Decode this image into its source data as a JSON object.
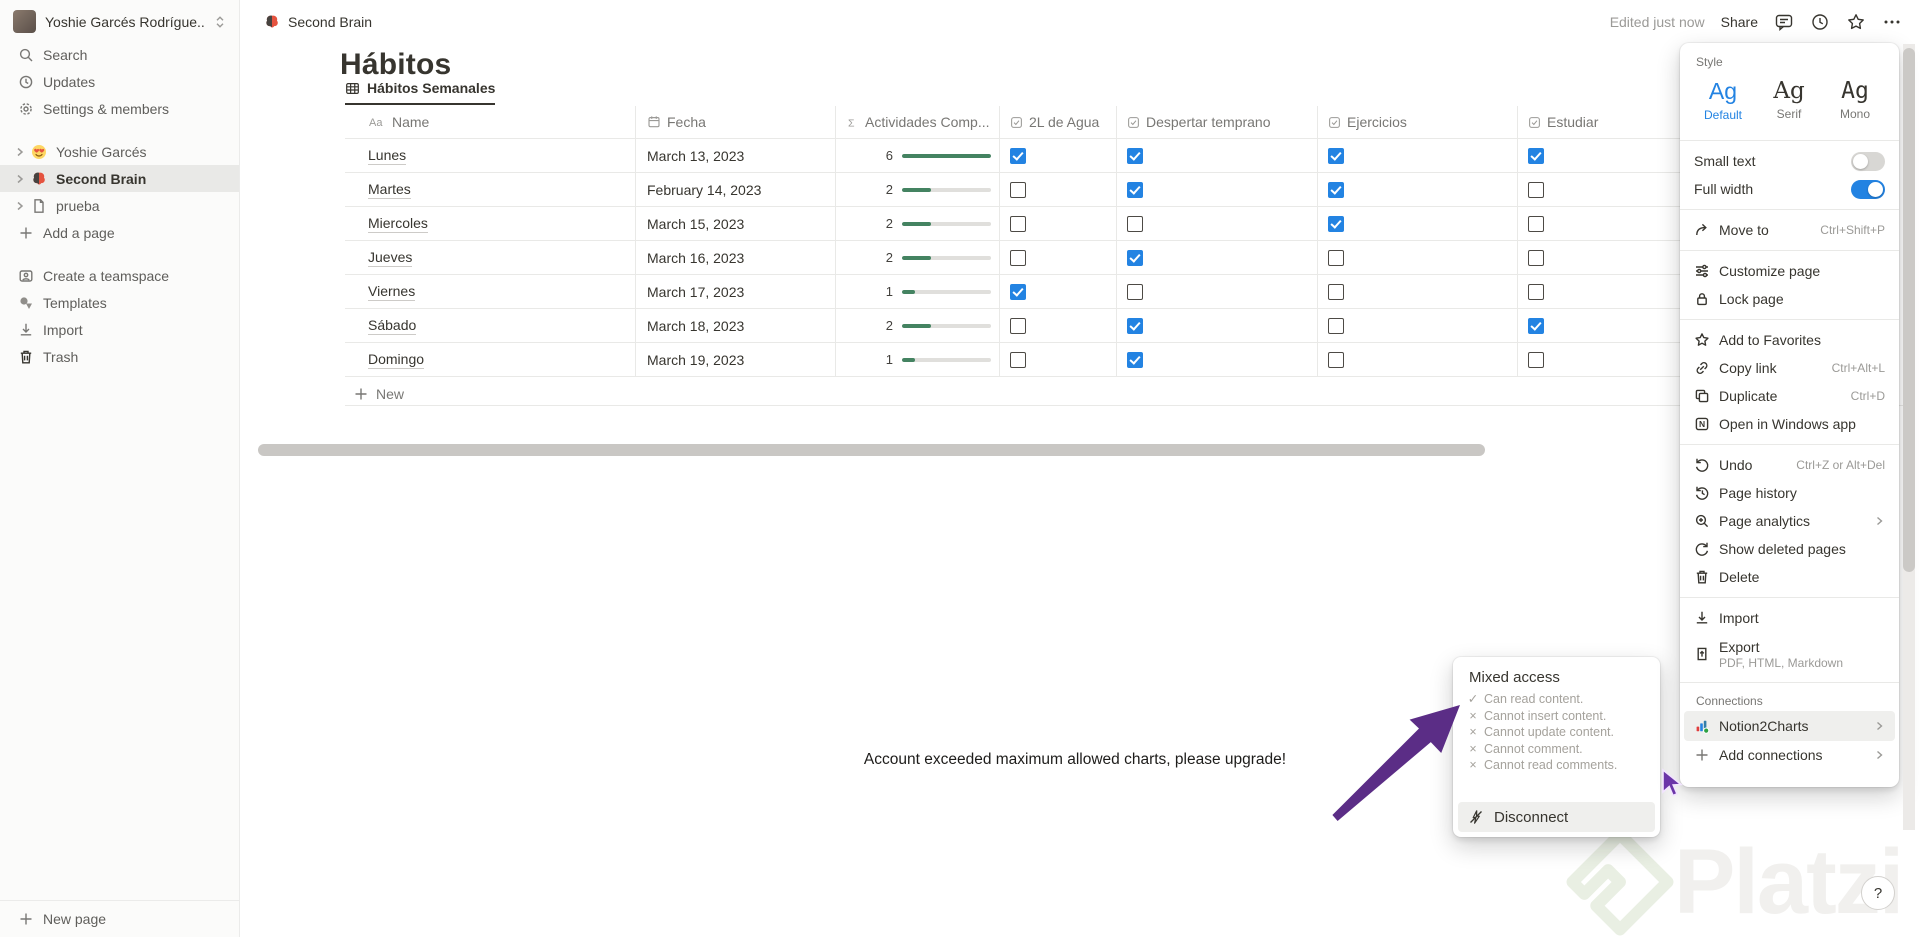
{
  "colors": {
    "accent": "#2383e2",
    "check_blue": "#2383e2",
    "progress_green": "#448361",
    "arrow_purple": "#5b2d86",
    "selected_bg": "#e9e9e7"
  },
  "sidebar": {
    "workspace": {
      "name": "Yoshie Garcés Rodrígue..."
    },
    "nav": [
      {
        "icon": "search",
        "label": "Search"
      },
      {
        "icon": "clock",
        "label": "Updates"
      },
      {
        "icon": "gear",
        "label": "Settings & members"
      }
    ],
    "pages": [
      {
        "icon": "emoji-love",
        "label": "Yoshie Garcés",
        "selected": false
      },
      {
        "icon": "brain",
        "label": "Second Brain",
        "selected": true
      },
      {
        "icon": "doc",
        "label": "prueba",
        "selected": false
      }
    ],
    "add_page": {
      "icon": "plus",
      "label": "Add a page"
    },
    "secondary": [
      {
        "icon": "teamspace",
        "label": "Create a teamspace"
      },
      {
        "icon": "templates",
        "label": "Templates"
      },
      {
        "icon": "import",
        "label": "Import"
      },
      {
        "icon": "trash",
        "label": "Trash"
      }
    ],
    "new_page": {
      "icon": "plus",
      "label": "New page"
    }
  },
  "topbar": {
    "breadcrumb": "Second Brain",
    "edited": "Edited just now",
    "share": "Share",
    "icons": [
      "comment",
      "clock",
      "star",
      "dots"
    ]
  },
  "page": {
    "title": "Hábitos",
    "tab": "Hábitos Semanales"
  },
  "table": {
    "columns": [
      {
        "icon": "aa",
        "label": "Name"
      },
      {
        "icon": "calendar",
        "label": "Fecha"
      },
      {
        "icon": "sigma",
        "label": "Actividades Comp..."
      },
      {
        "icon": "checkbox",
        "label": "2L de Agua"
      },
      {
        "icon": "checkbox",
        "label": "Despertar temprano"
      },
      {
        "icon": "checkbox",
        "label": "Ejercicios"
      },
      {
        "icon": "checkbox",
        "label": "Estudiar"
      }
    ],
    "rows": [
      {
        "name": "Lunes",
        "fecha": "March 13, 2023",
        "sum": "6",
        "pct": 100,
        "checks": [
          true,
          true,
          true,
          true
        ]
      },
      {
        "name": "Martes",
        "fecha": "February 14, 2023",
        "sum": "2",
        "pct": 33,
        "checks": [
          false,
          true,
          true,
          false
        ]
      },
      {
        "name": "Miercoles",
        "fecha": "March 15, 2023",
        "sum": "2",
        "pct": 33,
        "checks": [
          false,
          false,
          true,
          false
        ]
      },
      {
        "name": "Jueves",
        "fecha": "March 16, 2023",
        "sum": "2",
        "pct": 33,
        "checks": [
          false,
          true,
          false,
          false
        ]
      },
      {
        "name": "Viernes",
        "fecha": "March 17, 2023",
        "sum": "1",
        "pct": 15,
        "checks": [
          true,
          false,
          false,
          false
        ]
      },
      {
        "name": "Sábado",
        "fecha": "March 18, 2023",
        "sum": "2",
        "pct": 33,
        "checks": [
          false,
          true,
          false,
          true
        ]
      },
      {
        "name": "Domingo",
        "fecha": "March 19, 2023",
        "sum": "1",
        "pct": 15,
        "checks": [
          false,
          true,
          false,
          false
        ]
      }
    ],
    "new_row": "New"
  },
  "notice": "Account exceeded maximum allowed charts, please upgrade!",
  "tooltip": {
    "title": "Mixed access",
    "items": [
      {
        "mark": "check",
        "text": "Can read content."
      },
      {
        "mark": "x",
        "text": "Cannot insert content."
      },
      {
        "mark": "x",
        "text": "Cannot update content."
      },
      {
        "mark": "x",
        "text": "Cannot comment."
      },
      {
        "mark": "x",
        "text": "Cannot read comments."
      }
    ],
    "disconnect": "Disconnect"
  },
  "menu": {
    "sections": [
      {
        "type": "label",
        "text": "Style"
      },
      {
        "type": "fonts",
        "options": [
          {
            "sample": "Ag",
            "label": "Default",
            "cls": "default"
          },
          {
            "sample": "Ag",
            "label": "Serif",
            "cls": "serif"
          },
          {
            "sample": "Ag",
            "label": "Mono",
            "cls": "mono"
          }
        ]
      },
      {
        "type": "div"
      },
      {
        "type": "toggles",
        "items": [
          {
            "label": "Small text",
            "on": false
          },
          {
            "label": "Full width",
            "on": true
          }
        ]
      },
      {
        "type": "div"
      },
      {
        "type": "items",
        "items": [
          {
            "icon": "move-to",
            "label": "Move to",
            "shortcut": "Ctrl+Shift+P"
          }
        ]
      },
      {
        "type": "div"
      },
      {
        "type": "items",
        "items": [
          {
            "icon": "customize",
            "label": "Customize page"
          },
          {
            "icon": "lock",
            "label": "Lock page"
          }
        ]
      },
      {
        "type": "div"
      },
      {
        "type": "items",
        "items": [
          {
            "icon": "star",
            "label": "Add to Favorites"
          },
          {
            "icon": "link",
            "label": "Copy link",
            "shortcut": "Ctrl+Alt+L"
          },
          {
            "icon": "duplicate",
            "label": "Duplicate",
            "shortcut": "Ctrl+D"
          },
          {
            "icon": "napp",
            "label": "Open in Windows app"
          }
        ]
      },
      {
        "type": "div"
      },
      {
        "type": "items",
        "items": [
          {
            "icon": "undo",
            "label": "Undo",
            "shortcut": "Ctrl+Z or Alt+Del"
          },
          {
            "icon": "history",
            "label": "Page history"
          },
          {
            "icon": "analytics",
            "label": "Page analytics",
            "chevron": true
          },
          {
            "icon": "restore",
            "label": "Show deleted pages"
          },
          {
            "icon": "trash",
            "label": "Delete"
          }
        ]
      },
      {
        "type": "div"
      },
      {
        "type": "items",
        "items": [
          {
            "icon": "download",
            "label": "Import"
          },
          {
            "icon": "export",
            "label": "Export",
            "sub": "PDF, HTML, Markdown"
          }
        ]
      },
      {
        "type": "div"
      },
      {
        "type": "label",
        "text": "Connections"
      },
      {
        "type": "items",
        "items": [
          {
            "icon": "chart",
            "label": "Notion2Charts",
            "chevron": true,
            "highlight": true
          },
          {
            "icon": "plus",
            "label": "Add connections",
            "chevron": true
          }
        ]
      }
    ]
  },
  "watermark": {
    "text": "Platzi"
  },
  "help": "?"
}
